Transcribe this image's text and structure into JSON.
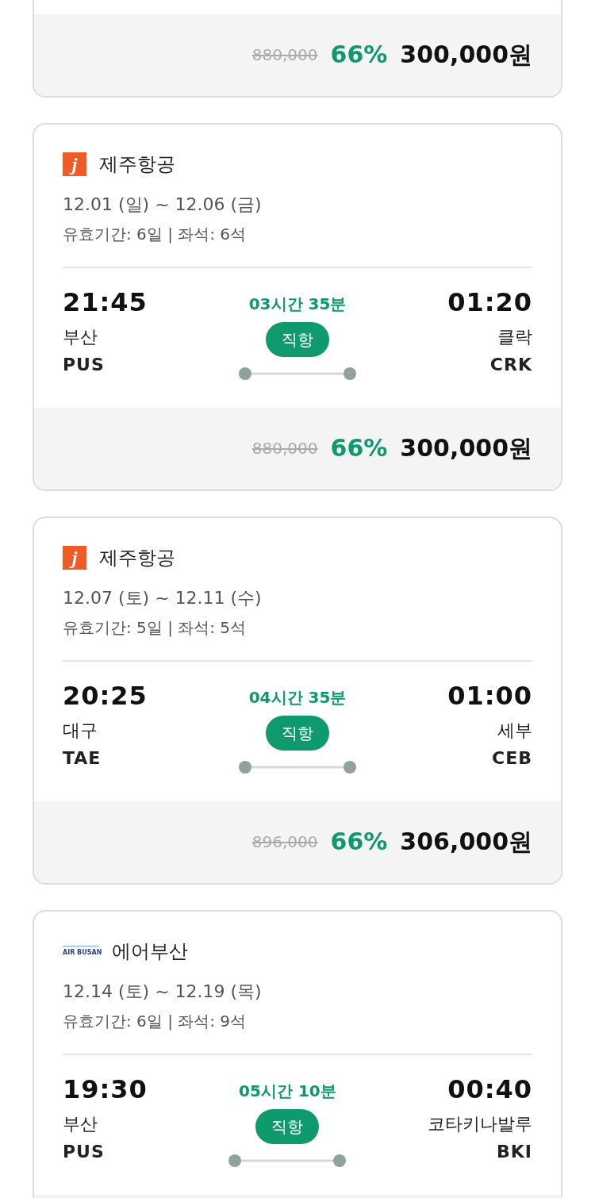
{
  "cards": [
    {
      "price": {
        "original": "880,000",
        "discount": "66%",
        "final": "300,000원"
      }
    },
    {
      "airline": {
        "kind": "jeju",
        "logo_text": "j",
        "name": "제주항공"
      },
      "dates": "12.01 (일) ~ 12.06 (금)",
      "validity": "유효기간: 6일 | 좌석: 6석",
      "departure": {
        "time": "21:45",
        "city": "부산",
        "code": "PUS"
      },
      "arrival": {
        "time": "01:20",
        "city": "클락",
        "code": "CRK"
      },
      "duration": "03시간 35분",
      "route_type": "직항",
      "price": {
        "original": "880,000",
        "discount": "66%",
        "final": "300,000원"
      }
    },
    {
      "airline": {
        "kind": "jeju",
        "logo_text": "j",
        "name": "제주항공"
      },
      "dates": "12.07 (토) ~ 12.11 (수)",
      "validity": "유효기간: 5일 | 좌석: 5석",
      "departure": {
        "time": "20:25",
        "city": "대구",
        "code": "TAE"
      },
      "arrival": {
        "time": "01:00",
        "city": "세부",
        "code": "CEB"
      },
      "duration": "04시간 35분",
      "route_type": "직항",
      "price": {
        "original": "896,000",
        "discount": "66%",
        "final": "306,000원"
      }
    },
    {
      "airline": {
        "kind": "airbusan",
        "logo_text": "AIR BUSAN",
        "name": "에어부산"
      },
      "dates": "12.14 (토) ~ 12.19 (목)",
      "validity": "유효기간: 6일 | 좌석: 9석",
      "departure": {
        "time": "19:30",
        "city": "부산",
        "code": "PUS"
      },
      "arrival": {
        "time": "00:40",
        "city": "코타키나발루",
        "code": "BKI"
      },
      "duration": "05시간 10분",
      "route_type": "직항"
    }
  ]
}
